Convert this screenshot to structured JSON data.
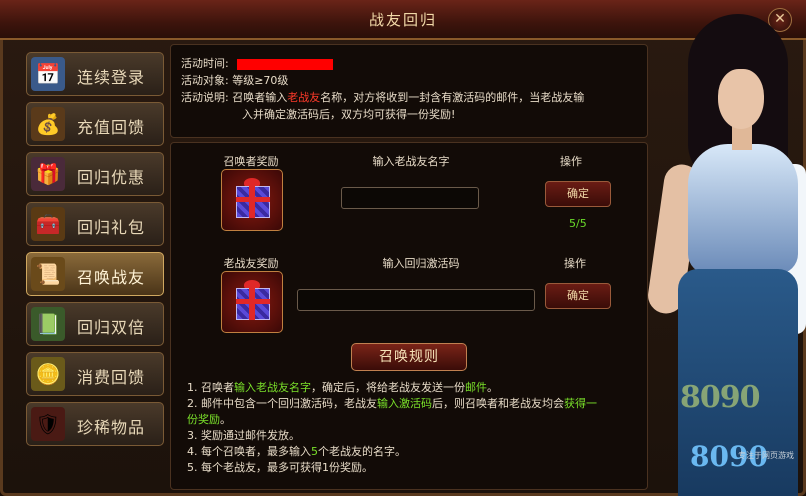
{
  "window": {
    "title": "战友回归",
    "close_label": "✕"
  },
  "sidebar": {
    "items": [
      {
        "label": "连续登录",
        "icon": "calendar-icon",
        "glyph": "📅",
        "active": false
      },
      {
        "label": "充值回馈",
        "icon": "money-bag-icon",
        "glyph": "💰",
        "active": false
      },
      {
        "label": "回归优惠",
        "icon": "gift-boxes-icon",
        "glyph": "🎁",
        "active": false
      },
      {
        "label": "回归礼包",
        "icon": "treasure-chest-icon",
        "glyph": "🧰",
        "active": false
      },
      {
        "label": "召唤战友",
        "icon": "scroll-icon",
        "glyph": "📜",
        "active": true
      },
      {
        "label": "回归双倍",
        "icon": "exp-scroll-icon",
        "glyph": "📗",
        "active": false
      },
      {
        "label": "消费回馈",
        "icon": "gold-ingots-icon",
        "glyph": "🪙",
        "active": false
      },
      {
        "label": "珍稀物品",
        "icon": "armor-icon",
        "glyph": "🛡",
        "active": false
      }
    ]
  },
  "info": {
    "time_label": "活动时间:",
    "target_label": "活动对象:",
    "target_value": "等级≥70级",
    "desc_label": "活动说明:",
    "desc_part1": "召唤者输入",
    "desc_highlight": "老战友",
    "desc_part2": "名称，对方将收到一封含有激活码的邮件，当老战友输",
    "desc_line2": "入并确定激活码后，双方均可获得一份奖励!"
  },
  "summoner": {
    "reward_header": "召唤者奖励",
    "input_header": "输入老战友名字",
    "action_header": "操作",
    "confirm_label": "确定",
    "count": "5/5",
    "input_value": ""
  },
  "veteran": {
    "reward_header": "老战友奖励",
    "input_header": "输入回归激活码",
    "action_header": "操作",
    "confirm_label": "确定",
    "input_value": ""
  },
  "rules": {
    "button_label": "召唤规则",
    "r1_a": "1. 召唤者",
    "r1_b": "输入老战友名字",
    "r1_c": "，确定后，将给老战友发送一份",
    "r1_d": "邮件",
    "r1_e": "。",
    "r2_a": "2. 邮件中包含一个回归激活码，老战友",
    "r2_b": "输入激活码",
    "r2_c": "后，则召唤者和老战友均会",
    "r2_d": "获得一",
    "r2_line2": "份奖励",
    "r2_end": "。",
    "r3": "3. 奖励通过邮件发放。",
    "r4_a": "4. 每个召唤者，最多输入",
    "r4_b": "5",
    "r4_c": "个老战友的名字。",
    "r5": "5. 每个老战友，最多可获得1份奖励。"
  },
  "branding": {
    "logo_top": "8090",
    "logo_bottom": "8090",
    "tagline": "专注于网页游戏"
  },
  "colors": {
    "accent_green": "#7ae02a",
    "accent_red": "#ff3a2a",
    "redacted_bar": "#ff0000"
  }
}
